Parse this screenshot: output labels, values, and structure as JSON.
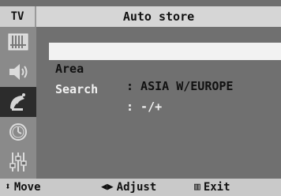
{
  "header": {
    "source": "TV",
    "title": "Auto store"
  },
  "menu_icons": [
    {
      "name": "picture-icon",
      "active": false
    },
    {
      "name": "sound-icon",
      "active": false
    },
    {
      "name": "channel-icon",
      "active": true
    },
    {
      "name": "timer-icon",
      "active": false
    },
    {
      "name": "setup-icon",
      "active": false
    }
  ],
  "rows": [
    {
      "label": "Area",
      "value": ": ASIA W/EUROPE",
      "selected": true
    },
    {
      "label": "Search",
      "value": ": -/+",
      "selected": false
    }
  ],
  "footer": {
    "move_icon": "⬍",
    "move_label": "Move",
    "adjust_icon": "◀▶",
    "adjust_label": "Adjust",
    "exit_icon": "▥",
    "exit_label": "Exit"
  },
  "colors": {
    "background": "#6f6f6f",
    "header": "#d6d6d6",
    "highlight": "#f2f2f2",
    "active_icon_bg": "#2c2c2c"
  }
}
